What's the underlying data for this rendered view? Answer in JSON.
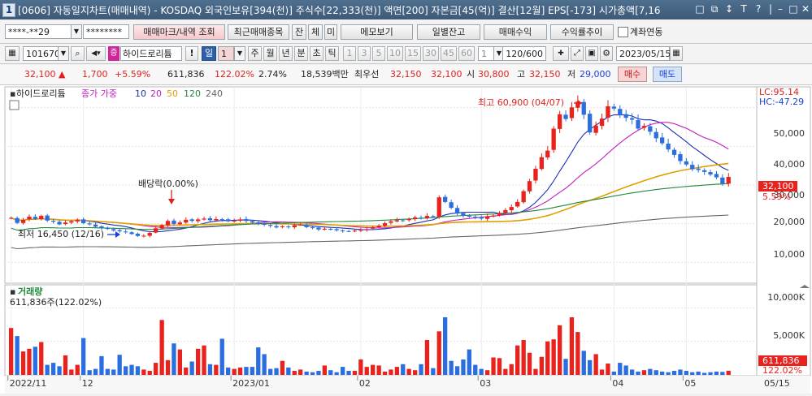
{
  "window": {
    "screen_no": "1",
    "title": "[0606] 자동일지차트(매매내역) - KOSDAQ 외국인보유[394(천)] 주식수[22,333(천)] 액면[200] 자본금[45(억)] 결산[12월] EPS[-173] 시가총액[7,16",
    "controls": [
      "□",
      "⧉",
      "↕",
      "T",
      "?",
      "|",
      "–",
      "□",
      "✕"
    ]
  },
  "toolbar1": {
    "account_no": "****-**29",
    "password": "********",
    "trade_mark_button": "매매마크/내역 조회",
    "recent_trades_button": "최근매매종목",
    "btn_jan": "잔",
    "btn_che": "체",
    "btn_mi": "미",
    "memo_button": "메모보기",
    "daily_balance_button": "일별잔고",
    "trade_profit_button": "매매수익",
    "return_trend_button": "수익률추이",
    "account_link_label": "계좌연동"
  },
  "toolbar2": {
    "stock_code": "101670",
    "stock_name": "하이드로리튬",
    "period_selected": "일",
    "period_value": "1",
    "periods": [
      "주",
      "월",
      "년",
      "분",
      "초",
      "틱"
    ],
    "intervals": [
      "1",
      "3",
      "5",
      "10",
      "15",
      "30",
      "45",
      "60"
    ],
    "interval_value": "1",
    "count": "120/600",
    "date": "2023/05/15"
  },
  "quote": {
    "price": "32,100",
    "arrow": "▲",
    "change": "1,700",
    "change_pct": "+5.59%",
    "volume": "611,836",
    "volume_ratio": "122.02%",
    "turnover": "2.74%",
    "amount": "18,539백만",
    "best_ask_label": "최우선",
    "best_ask": "32,150",
    "best_bid": "32,100",
    "open_label": "시",
    "open": "30,800",
    "high_label": "고",
    "high": "32,150",
    "low_label": "저",
    "low": "29,000",
    "buy_button": "매수",
    "sell_button": "매도"
  },
  "chart": {
    "stock_label": "하이드로리튬",
    "legend_label": "종가 가중",
    "ma_periods": [
      "10",
      "20",
      "50",
      "120",
      "240"
    ],
    "ma_colors": [
      "#1a2fb8",
      "#c21fc2",
      "#e0a000",
      "#1f8a3a",
      "#666666"
    ],
    "up_color": "#e8221c",
    "down_color": "#2b6ee0",
    "lc": "LC:95.14",
    "hc": "HC:-47.29",
    "price_ticks": [
      "50,000",
      "40,000",
      "30,000",
      "20,000",
      "10,000"
    ],
    "last_price_tag": "32,100",
    "last_pct_tag": "5.59%",
    "high_note": "최고 60,900 (04/07)",
    "low_note": "최저 16,450 (12/16)",
    "dividend_note": "배당락(0.00%)",
    "volume_title": "거래량",
    "volume_value": "611,836주(122.02%)",
    "volume_ticks": [
      "10,000K",
      "5,000K"
    ],
    "volume_tag": "611,836",
    "volume_pct_tag": "122.02%",
    "date_ticks": [
      "2022/11",
      "12",
      "2023/01",
      "02",
      "03",
      "04",
      "05"
    ],
    "date_end": "05/15"
  },
  "chart_data": {
    "type": "candlestick",
    "y_axis": {
      "min": 5000,
      "max": 55000,
      "unit": "원"
    },
    "volume_axis": {
      "max": 11500,
      "unit": "K"
    },
    "closes": [
      21500,
      20200,
      21000,
      21800,
      21200,
      22000,
      20800,
      20500,
      19800,
      20300,
      20600,
      21000,
      20100,
      19800,
      19200,
      18900,
      18600,
      18200,
      18000,
      17800,
      17300,
      16800,
      16900,
      17600,
      18800,
      19600,
      20700,
      19900,
      20300,
      21000,
      20700,
      21100,
      21300,
      20900,
      21200,
      21000,
      20600,
      20800,
      21100,
      20700,
      20300,
      19900,
      19700,
      19400,
      19000,
      19300,
      19100,
      19600,
      19700,
      19100,
      18900,
      18500,
      18700,
      18500,
      18300,
      18100,
      18000,
      18200,
      18400,
      18600,
      19100,
      19500,
      20100,
      20600,
      20900,
      20800,
      21200,
      21600,
      21300,
      22000,
      21800,
      26800,
      25600,
      24100,
      22600,
      22100,
      21800,
      21500,
      21300,
      21900,
      22100,
      22800,
      23500,
      24300,
      25600,
      28400,
      31000,
      34200,
      37200,
      38900,
      44600,
      48300,
      47100,
      50100,
      51600,
      48200,
      43600,
      45400,
      47200,
      50400,
      49800,
      48100,
      47400,
      46900,
      44600,
      45300,
      43800,
      42100,
      40800,
      39200,
      37800,
      36200,
      35300,
      34100,
      33900,
      33400,
      32700,
      32000,
      30400,
      32100
    ],
    "volumes_k": [
      7000,
      5800,
      3500,
      3900,
      4200,
      4900,
      1500,
      1800,
      1300,
      2900,
      800,
      1500,
      5500,
      700,
      900,
      2800,
      900,
      800,
      3000,
      1300,
      1500,
      1300,
      800,
      600,
      1800,
      8200,
      2200,
      4700,
      3800,
      1100,
      2000,
      3900,
      4400,
      1600,
      1500,
      5400,
      1100,
      900,
      1100,
      1200,
      1200,
      4100,
      3100,
      900,
      1000,
      2100,
      1100,
      600,
      800,
      500,
      400,
      600,
      1400,
      700,
      400,
      1200,
      600,
      600,
      2300,
      1200,
      1500,
      1400,
      500,
      800,
      1200,
      1600,
      900,
      700,
      1600,
      5200,
      1000,
      6500,
      8600,
      2100,
      1300,
      2300,
      3800,
      1500,
      900,
      700,
      2600,
      2500,
      900,
      1600,
      4400,
      5200,
      3300,
      900,
      2700,
      5000,
      5300,
      7400,
      2400,
      8600,
      6400,
      3600,
      2200,
      3100,
      800,
      1700,
      500,
      1800,
      1400,
      800,
      500,
      700,
      900,
      700,
      500,
      400,
      600,
      800,
      600,
      400,
      500,
      300,
      400,
      500,
      450,
      612
    ]
  }
}
